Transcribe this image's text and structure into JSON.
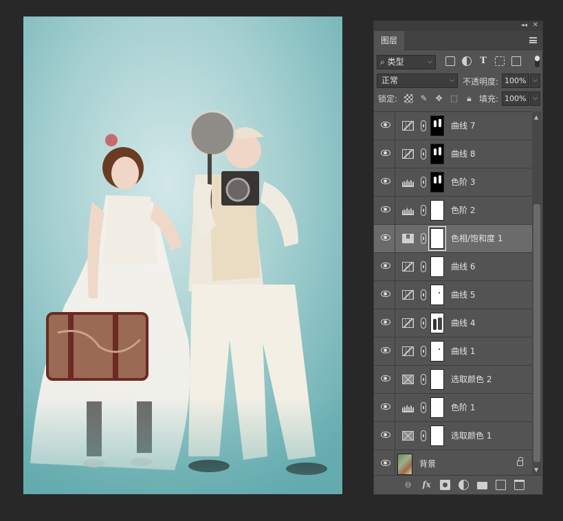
{
  "panel": {
    "tab_label": "图层",
    "filter_label": "类型",
    "blend_mode": "正常",
    "opacity_label": "不透明度:",
    "opacity_value": "100%",
    "lock_label": "锁定:",
    "fill_label": "填充:",
    "fill_value": "100%"
  },
  "layers": [
    {
      "name": "曲线 7",
      "type": "curves",
      "mask": "black"
    },
    {
      "name": "曲线 8",
      "type": "curves",
      "mask": "black"
    },
    {
      "name": "色阶 3",
      "type": "levels",
      "mask": "black"
    },
    {
      "name": "色阶 2",
      "type": "levels",
      "mask": "white"
    },
    {
      "name": "色相/饱和度 1",
      "type": "hue",
      "mask": "white",
      "selected": true
    },
    {
      "name": "曲线 6",
      "type": "curves",
      "mask": "white"
    },
    {
      "name": "曲线 5",
      "type": "curves",
      "mask": "dot"
    },
    {
      "name": "曲线 4",
      "type": "curves",
      "mask": "figs"
    },
    {
      "name": "曲线 1",
      "type": "curves",
      "mask": "dot"
    },
    {
      "name": "选取颜色 2",
      "type": "selcolor",
      "mask": "white"
    },
    {
      "name": "色阶 1",
      "type": "levels",
      "mask": "white"
    },
    {
      "name": "选取颜色 1",
      "type": "selcolor",
      "mask": "white"
    }
  ],
  "background_layer": {
    "name": "背景",
    "locked": true
  },
  "bottom_icons": [
    "link-layers-icon",
    "fx-icon",
    "add-mask-icon",
    "adjustment-layer-icon",
    "group-folder-icon",
    "new-layer-icon",
    "trash-icon"
  ]
}
